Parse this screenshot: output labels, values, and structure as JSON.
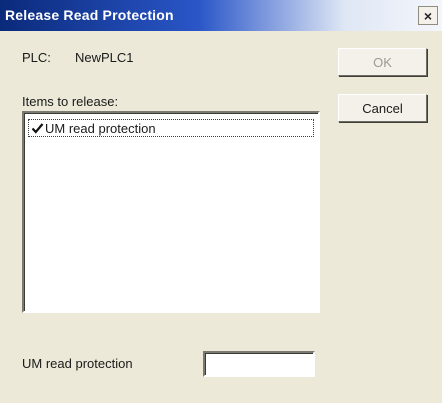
{
  "window": {
    "title": "Release Read Protection",
    "close_symbol": "×"
  },
  "plc": {
    "label": "PLC:",
    "value": "NewPLC1"
  },
  "items": {
    "label": "Items to release:",
    "list": [
      {
        "label": "UM read protection",
        "checked": true
      }
    ]
  },
  "buttons": {
    "ok_label": "OK",
    "ok_enabled": false,
    "cancel_label": "Cancel"
  },
  "um_protection": {
    "label": "UM read protection",
    "value": ""
  },
  "icons": {
    "checkbox": "checkmark-icon",
    "close": "close-icon"
  }
}
